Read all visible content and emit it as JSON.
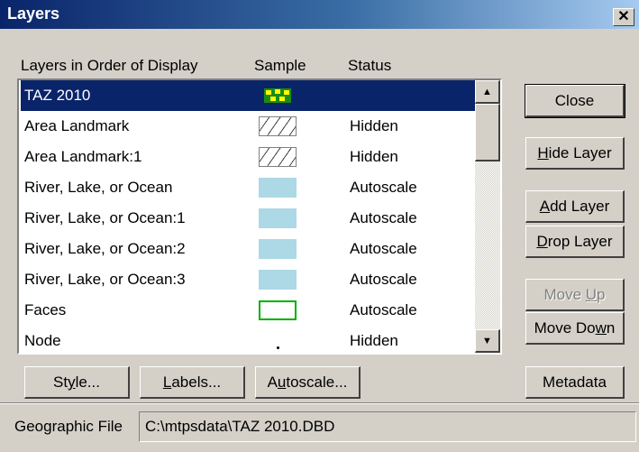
{
  "window": {
    "title": "Layers",
    "close_glyph": "✕"
  },
  "list": {
    "headers": {
      "name": "Layers in Order of Display",
      "sample": "Sample",
      "status": "Status"
    },
    "rows": [
      {
        "name": "TAZ 2010",
        "sample": "taz-pattern",
        "status": "",
        "selected": true
      },
      {
        "name": "Area Landmark",
        "sample": "hatch",
        "status": "Hidden"
      },
      {
        "name": "Area Landmark:1",
        "sample": "hatch",
        "status": "Hidden"
      },
      {
        "name": "River, Lake, or Ocean",
        "sample": "light-blue-fill",
        "status": "Autoscale"
      },
      {
        "name": "River, Lake, or Ocean:1",
        "sample": "light-blue-fill",
        "status": "Autoscale"
      },
      {
        "name": "River, Lake, or Ocean:2",
        "sample": "light-blue-fill",
        "status": "Autoscale"
      },
      {
        "name": "River, Lake, or Ocean:3",
        "sample": "light-blue-fill",
        "status": "Autoscale"
      },
      {
        "name": "Faces",
        "sample": "green-outline",
        "status": "Autoscale"
      },
      {
        "name": "Node",
        "sample": "dot",
        "status": "Hidden"
      }
    ]
  },
  "buttons": {
    "close": "Close",
    "hide_layer": {
      "pre": "",
      "u": "H",
      "post": "ide Layer"
    },
    "add_layer": {
      "pre": "",
      "u": "A",
      "post": "dd Layer"
    },
    "drop_layer": {
      "pre": "",
      "u": "D",
      "post": "rop Layer"
    },
    "move_up": {
      "pre": "Move ",
      "u": "U",
      "post": "p"
    },
    "move_down": {
      "pre": "Move Do",
      "u": "w",
      "post": "n"
    },
    "metadata": "Metadata",
    "style": {
      "pre": "St",
      "u": "y",
      "post": "le..."
    },
    "labels": {
      "pre": "",
      "u": "L",
      "post": "abels..."
    },
    "autoscale": {
      "pre": "A",
      "u": "u",
      "post": "toscale..."
    }
  },
  "footer": {
    "label": "Geographic File",
    "path": "C:\\mtpsdata\\TAZ 2010.DBD"
  },
  "colors": {
    "selection": "#0a246a",
    "water": "#add8e6",
    "faces": "#00b000",
    "taz_yellow": "#ffff00",
    "taz_green": "#1a8c1a"
  }
}
